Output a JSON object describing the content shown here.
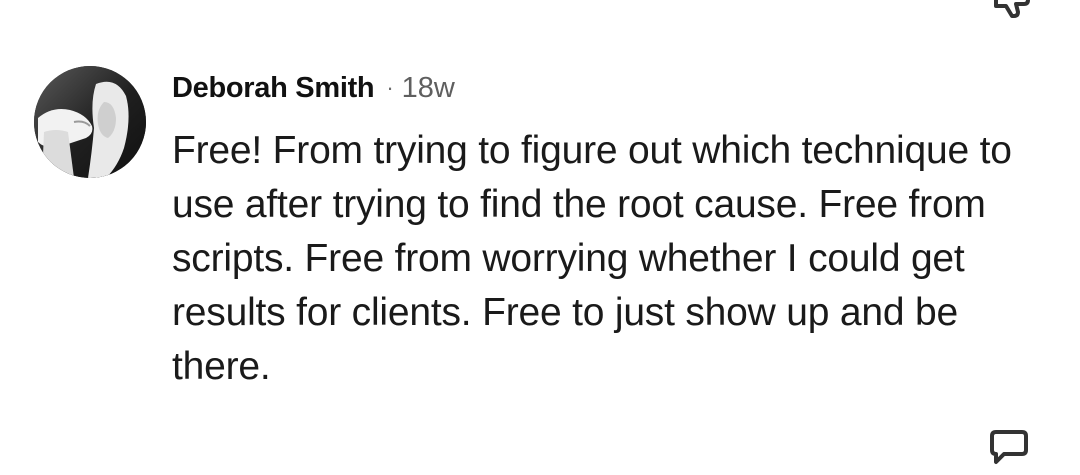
{
  "comment": {
    "author": "Deborah Smith",
    "separator": "·",
    "age": "18w",
    "text": "Free! From trying to figure out which technique to use after trying to find the root cause. Free from scripts. Free from worrying whether I could get results for clients. Free to just show up and be there."
  },
  "icons": {
    "avatar": "avatar-photo",
    "top_right": "thumbs-down-icon",
    "bottom_right": "reply-bubble-icon"
  }
}
